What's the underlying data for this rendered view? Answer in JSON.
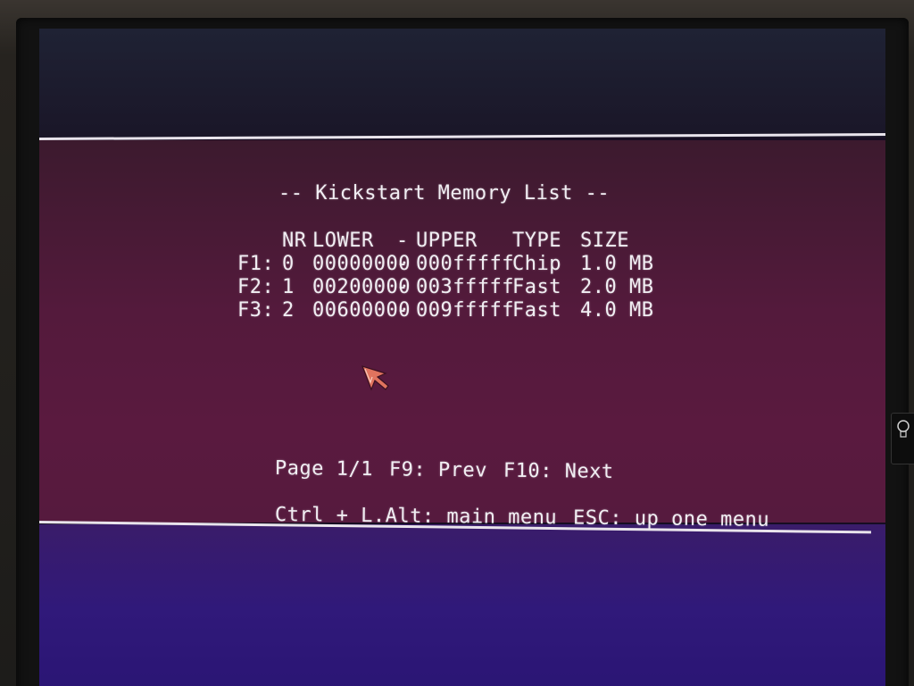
{
  "title": "-- Kickstart Memory List --",
  "table": {
    "headers": {
      "nr": "NR",
      "lower": "LOWER",
      "dash": "-",
      "upper": "UPPER",
      "type": "TYPE",
      "size": "SIZE"
    },
    "rows": [
      {
        "key": "F1:",
        "nr": "0",
        "lower": "00000000",
        "dash": "-",
        "upper": "000fffff",
        "type": "Chip",
        "size": "1.0 MB"
      },
      {
        "key": "F2:",
        "nr": "1",
        "lower": "00200000",
        "dash": "-",
        "upper": "003fffff",
        "type": "Fast",
        "size": "2.0 MB"
      },
      {
        "key": "F3:",
        "nr": "2",
        "lower": "00600000",
        "dash": "-",
        "upper": "009fffff",
        "type": "Fast",
        "size": "4.0 MB"
      }
    ]
  },
  "footer": {
    "page": "Page 1/1",
    "prev": "F9: Prev",
    "next": "F10: Next",
    "main_menu": "Ctrl + L.Alt: main menu",
    "up_menu": "ESC: up one menu"
  },
  "colors": {
    "text": "#f1eef3",
    "band_top": "#1f2234",
    "band_mid": "#541a3c",
    "band_bottom": "#30197a",
    "rule": "#e9e4ec",
    "pointer": "#e0735e"
  },
  "icons": {
    "pointer": "mouse-pointer-icon",
    "badge": "lightbulb-icon"
  }
}
